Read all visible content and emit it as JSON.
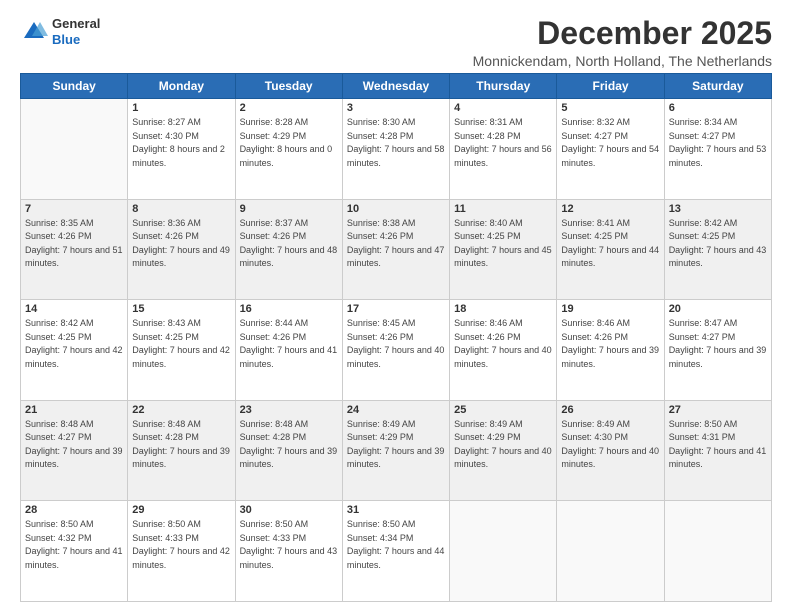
{
  "header": {
    "logo": {
      "line1": "General",
      "line2": "Blue"
    },
    "title": "December 2025",
    "location": "Monnickendam, North Holland, The Netherlands"
  },
  "weekdays": [
    "Sunday",
    "Monday",
    "Tuesday",
    "Wednesday",
    "Thursday",
    "Friday",
    "Saturday"
  ],
  "weeks": [
    [
      {
        "day": "",
        "sunrise": "",
        "sunset": "",
        "daylight": ""
      },
      {
        "day": "1",
        "sunrise": "Sunrise: 8:27 AM",
        "sunset": "Sunset: 4:30 PM",
        "daylight": "Daylight: 8 hours and 2 minutes."
      },
      {
        "day": "2",
        "sunrise": "Sunrise: 8:28 AM",
        "sunset": "Sunset: 4:29 PM",
        "daylight": "Daylight: 8 hours and 0 minutes."
      },
      {
        "day": "3",
        "sunrise": "Sunrise: 8:30 AM",
        "sunset": "Sunset: 4:28 PM",
        "daylight": "Daylight: 7 hours and 58 minutes."
      },
      {
        "day": "4",
        "sunrise": "Sunrise: 8:31 AM",
        "sunset": "Sunset: 4:28 PM",
        "daylight": "Daylight: 7 hours and 56 minutes."
      },
      {
        "day": "5",
        "sunrise": "Sunrise: 8:32 AM",
        "sunset": "Sunset: 4:27 PM",
        "daylight": "Daylight: 7 hours and 54 minutes."
      },
      {
        "day": "6",
        "sunrise": "Sunrise: 8:34 AM",
        "sunset": "Sunset: 4:27 PM",
        "daylight": "Daylight: 7 hours and 53 minutes."
      }
    ],
    [
      {
        "day": "7",
        "sunrise": "Sunrise: 8:35 AM",
        "sunset": "Sunset: 4:26 PM",
        "daylight": "Daylight: 7 hours and 51 minutes."
      },
      {
        "day": "8",
        "sunrise": "Sunrise: 8:36 AM",
        "sunset": "Sunset: 4:26 PM",
        "daylight": "Daylight: 7 hours and 49 minutes."
      },
      {
        "day": "9",
        "sunrise": "Sunrise: 8:37 AM",
        "sunset": "Sunset: 4:26 PM",
        "daylight": "Daylight: 7 hours and 48 minutes."
      },
      {
        "day": "10",
        "sunrise": "Sunrise: 8:38 AM",
        "sunset": "Sunset: 4:26 PM",
        "daylight": "Daylight: 7 hours and 47 minutes."
      },
      {
        "day": "11",
        "sunrise": "Sunrise: 8:40 AM",
        "sunset": "Sunset: 4:25 PM",
        "daylight": "Daylight: 7 hours and 45 minutes."
      },
      {
        "day": "12",
        "sunrise": "Sunrise: 8:41 AM",
        "sunset": "Sunset: 4:25 PM",
        "daylight": "Daylight: 7 hours and 44 minutes."
      },
      {
        "day": "13",
        "sunrise": "Sunrise: 8:42 AM",
        "sunset": "Sunset: 4:25 PM",
        "daylight": "Daylight: 7 hours and 43 minutes."
      }
    ],
    [
      {
        "day": "14",
        "sunrise": "Sunrise: 8:42 AM",
        "sunset": "Sunset: 4:25 PM",
        "daylight": "Daylight: 7 hours and 42 minutes."
      },
      {
        "day": "15",
        "sunrise": "Sunrise: 8:43 AM",
        "sunset": "Sunset: 4:25 PM",
        "daylight": "Daylight: 7 hours and 42 minutes."
      },
      {
        "day": "16",
        "sunrise": "Sunrise: 8:44 AM",
        "sunset": "Sunset: 4:26 PM",
        "daylight": "Daylight: 7 hours and 41 minutes."
      },
      {
        "day": "17",
        "sunrise": "Sunrise: 8:45 AM",
        "sunset": "Sunset: 4:26 PM",
        "daylight": "Daylight: 7 hours and 40 minutes."
      },
      {
        "day": "18",
        "sunrise": "Sunrise: 8:46 AM",
        "sunset": "Sunset: 4:26 PM",
        "daylight": "Daylight: 7 hours and 40 minutes."
      },
      {
        "day": "19",
        "sunrise": "Sunrise: 8:46 AM",
        "sunset": "Sunset: 4:26 PM",
        "daylight": "Daylight: 7 hours and 39 minutes."
      },
      {
        "day": "20",
        "sunrise": "Sunrise: 8:47 AM",
        "sunset": "Sunset: 4:27 PM",
        "daylight": "Daylight: 7 hours and 39 minutes."
      }
    ],
    [
      {
        "day": "21",
        "sunrise": "Sunrise: 8:48 AM",
        "sunset": "Sunset: 4:27 PM",
        "daylight": "Daylight: 7 hours and 39 minutes."
      },
      {
        "day": "22",
        "sunrise": "Sunrise: 8:48 AM",
        "sunset": "Sunset: 4:28 PM",
        "daylight": "Daylight: 7 hours and 39 minutes."
      },
      {
        "day": "23",
        "sunrise": "Sunrise: 8:48 AM",
        "sunset": "Sunset: 4:28 PM",
        "daylight": "Daylight: 7 hours and 39 minutes."
      },
      {
        "day": "24",
        "sunrise": "Sunrise: 8:49 AM",
        "sunset": "Sunset: 4:29 PM",
        "daylight": "Daylight: 7 hours and 39 minutes."
      },
      {
        "day": "25",
        "sunrise": "Sunrise: 8:49 AM",
        "sunset": "Sunset: 4:29 PM",
        "daylight": "Daylight: 7 hours and 40 minutes."
      },
      {
        "day": "26",
        "sunrise": "Sunrise: 8:49 AM",
        "sunset": "Sunset: 4:30 PM",
        "daylight": "Daylight: 7 hours and 40 minutes."
      },
      {
        "day": "27",
        "sunrise": "Sunrise: 8:50 AM",
        "sunset": "Sunset: 4:31 PM",
        "daylight": "Daylight: 7 hours and 41 minutes."
      }
    ],
    [
      {
        "day": "28",
        "sunrise": "Sunrise: 8:50 AM",
        "sunset": "Sunset: 4:32 PM",
        "daylight": "Daylight: 7 hours and 41 minutes."
      },
      {
        "day": "29",
        "sunrise": "Sunrise: 8:50 AM",
        "sunset": "Sunset: 4:33 PM",
        "daylight": "Daylight: 7 hours and 42 minutes."
      },
      {
        "day": "30",
        "sunrise": "Sunrise: 8:50 AM",
        "sunset": "Sunset: 4:33 PM",
        "daylight": "Daylight: 7 hours and 43 minutes."
      },
      {
        "day": "31",
        "sunrise": "Sunrise: 8:50 AM",
        "sunset": "Sunset: 4:34 PM",
        "daylight": "Daylight: 7 hours and 44 minutes."
      },
      {
        "day": "",
        "sunrise": "",
        "sunset": "",
        "daylight": ""
      },
      {
        "day": "",
        "sunrise": "",
        "sunset": "",
        "daylight": ""
      },
      {
        "day": "",
        "sunrise": "",
        "sunset": "",
        "daylight": ""
      }
    ]
  ]
}
